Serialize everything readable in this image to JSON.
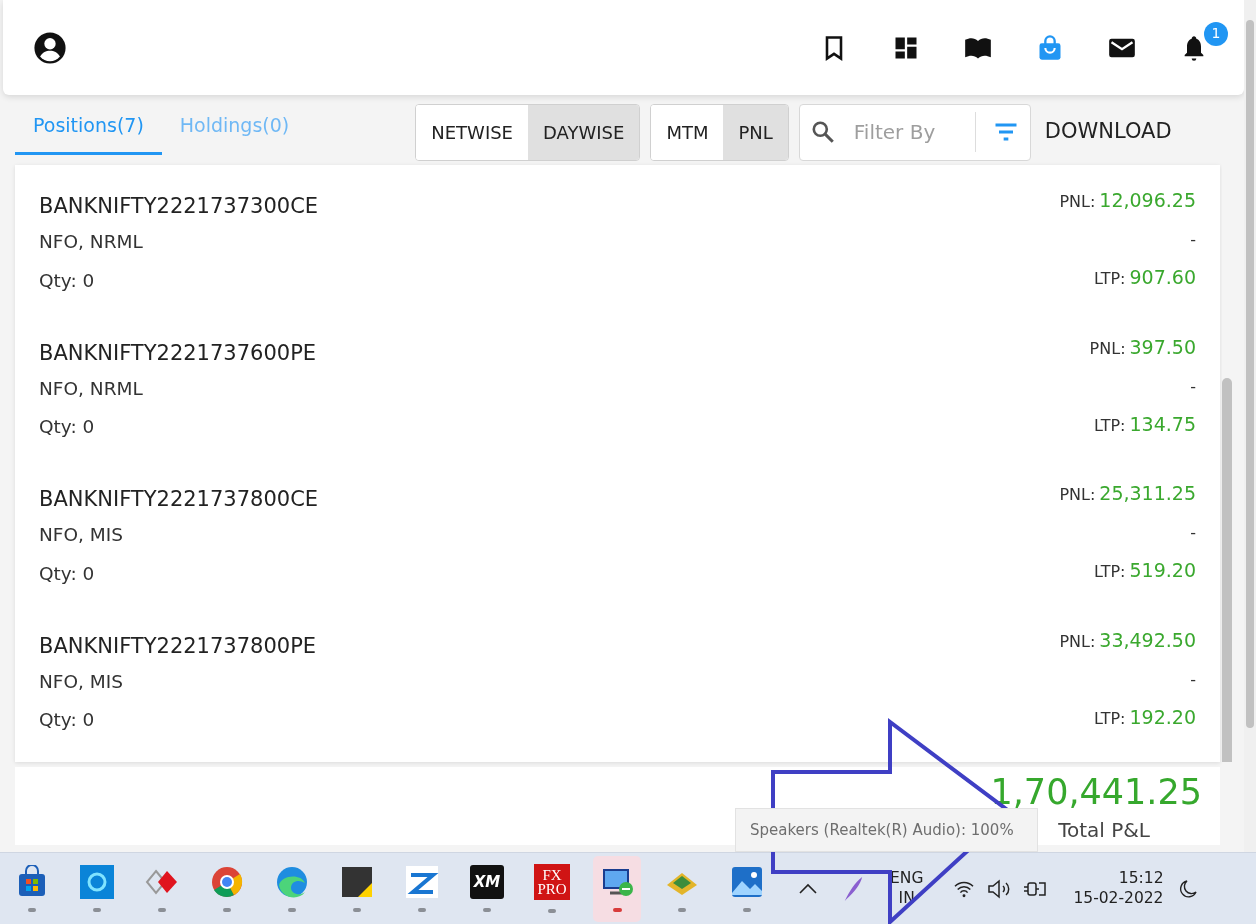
{
  "top_bar": {
    "notification_count": "1",
    "icons": [
      {
        "kind": "bookmark",
        "selected": false
      },
      {
        "kind": "dashboard",
        "selected": false
      },
      {
        "kind": "book",
        "selected": false
      },
      {
        "kind": "bag",
        "selected": true
      },
      {
        "kind": "mail",
        "selected": false
      },
      {
        "kind": "bell",
        "selected": false
      }
    ]
  },
  "tabs": [
    {
      "label": "Positions(7)",
      "selected": true
    },
    {
      "label": "Holdings(0)",
      "selected": false
    }
  ],
  "view_toggle": [
    {
      "label": "NETWISE",
      "selected": false
    },
    {
      "label": "DAYWISE",
      "selected": true
    }
  ],
  "value_toggle": [
    {
      "label": "MTM",
      "selected": false
    },
    {
      "label": "PNL",
      "selected": true
    }
  ],
  "filter": {
    "placeholder": "Filter By"
  },
  "download": "DOWNLOAD",
  "positions": [
    {
      "symbol": "BANKNIFTY2221737300CE",
      "segment": "NFO, NRML",
      "qty": "Qty: 0",
      "pnl_label": "PNL:",
      "pnl": "12,096.25",
      "change": "-",
      "ltp_label": "LTP:",
      "ltp": "907.60"
    },
    {
      "symbol": "BANKNIFTY2221737600PE",
      "segment": "NFO, NRML",
      "qty": "Qty: 0",
      "pnl_label": "PNL:",
      "pnl": "397.50",
      "change": "-",
      "ltp_label": "LTP:",
      "ltp": "134.75"
    },
    {
      "symbol": "BANKNIFTY2221737800CE",
      "segment": "NFO, MIS",
      "qty": "Qty: 0",
      "pnl_label": "PNL:",
      "pnl": "25,311.25",
      "change": "-",
      "ltp_label": "LTP:",
      "ltp": "519.20"
    },
    {
      "symbol": "BANKNIFTY2221737800PE",
      "segment": "NFO, MIS",
      "qty": "Qty: 0",
      "pnl_label": "PNL:",
      "pnl": "33,492.50",
      "change": "-",
      "ltp_label": "LTP:",
      "ltp": "192.20"
    }
  ],
  "total": {
    "value": "1,70,441.25",
    "label": "Total P&L"
  },
  "tooltip": "Speakers (Realtek(R) Audio): 100%",
  "taskbar": {
    "apps": [
      {
        "kind": "store",
        "active": false
      },
      {
        "kind": "assistant",
        "active": false
      },
      {
        "kind": "diamond",
        "active": false
      },
      {
        "kind": "chrome",
        "active": false
      },
      {
        "kind": "edge",
        "active": false
      },
      {
        "kind": "notes",
        "active": false
      },
      {
        "kind": "zlogo",
        "active": false
      },
      {
        "kind": "xm",
        "label": "XM",
        "active": false
      },
      {
        "kind": "fxpro",
        "label": "FX PRO",
        "active": false
      },
      {
        "kind": "remote",
        "active": true
      },
      {
        "kind": "folder",
        "active": false
      },
      {
        "kind": "photos",
        "active": false
      }
    ],
    "language": "ENG",
    "region": "IN",
    "time": "15:12",
    "date": "15-02-2022"
  }
}
